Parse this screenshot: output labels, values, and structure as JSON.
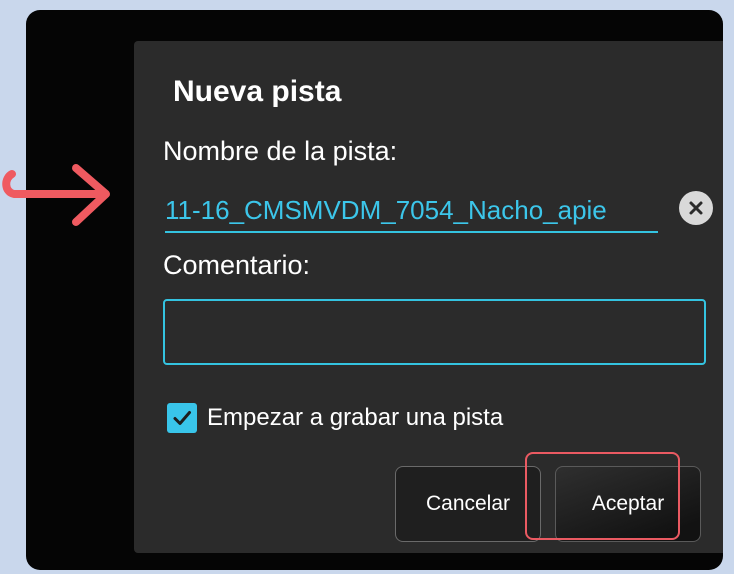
{
  "dialog": {
    "title": "Nueva pista",
    "track_name_label": "Nombre de la pista:",
    "track_name_value": "11-16_CMSMVDM_7054_Nacho_apie",
    "comment_label": "Comentario:",
    "comment_value": "",
    "start_recording_label": "Empezar a grabar una pista",
    "start_recording_checked": true,
    "cancel_label": "Cancelar",
    "accept_label": "Aceptar"
  },
  "icons": {
    "clear": "close-circle-icon",
    "checkbox": "check-icon",
    "annotation": "arrow-right-icon"
  },
  "colors": {
    "accent": "#34c3e0",
    "highlight": "#ea5a62",
    "dialog_bg": "#2b2b2b",
    "backdrop": "#c9d7ec"
  }
}
